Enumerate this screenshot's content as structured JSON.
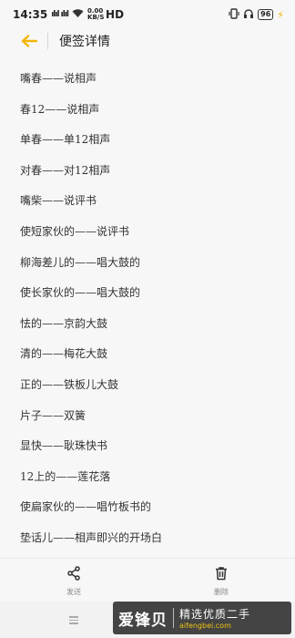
{
  "status_bar": {
    "time": "14:35",
    "signal": "ılıl ılıl",
    "wifi_icon": "wifi-icon",
    "speed": "0.00 KB/S",
    "hd": "HD",
    "battery": "96"
  },
  "header": {
    "back_icon": "arrow-left-icon",
    "title": "便签详情",
    "accent_color": "#f2b50a"
  },
  "note_lines": [
    "嘴春——说相声",
    "春12——说相声",
    "单春——单12相声",
    "对春——对12相声",
    "嘴柴——说评书",
    "使短家伙的——说评书",
    "柳海差儿的——唱大鼓的",
    "使长家伙的——唱大鼓的",
    "怯的——京韵大鼓",
    "清的——梅花大鼓",
    "正的——铁板儿大鼓",
    "片子——双簧",
    "显快——耿珠快书",
    "12上的——莲花落",
    "使扁家伙的——唱竹板书的",
    "垫话儿——相声即兴的开场白"
  ],
  "bottom_bar": {
    "share_label": "发送",
    "delete_label": "删除"
  },
  "watermark": {
    "logo": "爱锋贝",
    "slogan": "精选优质二手",
    "url": "aifengbei.com"
  }
}
